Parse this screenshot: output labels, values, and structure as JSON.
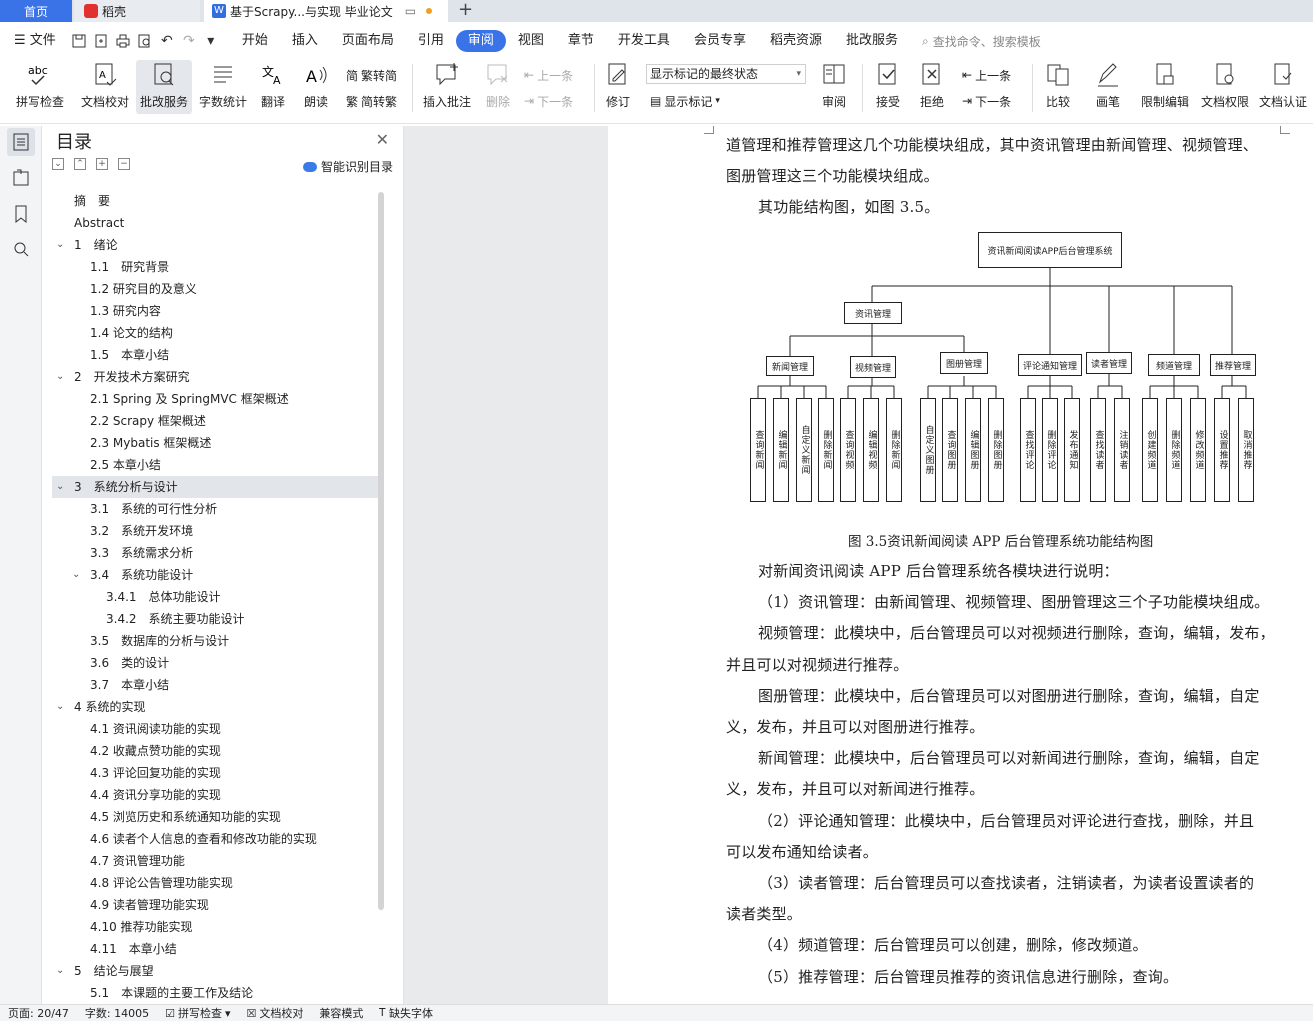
{
  "tabs": {
    "home": "首页",
    "daoke": "稻壳",
    "doc_title": "基于Scrapy...与实现 毕业论文"
  },
  "menu": {
    "file": "文件",
    "items": [
      "开始",
      "插入",
      "页面布局",
      "引用",
      "审阅",
      "视图",
      "章节",
      "开发工具",
      "会员专享",
      "稻壳资源",
      "批改服务"
    ],
    "search_placeholder": "查找命令、搜索模板"
  },
  "ribbon": {
    "spell_check": "拼写检查",
    "doc_proof": "文档校对",
    "correction_service": "批改服务",
    "word_count": "字数统计",
    "translate": "翻译",
    "read_aloud": "朗读",
    "trad_to_simp": "繁转简",
    "simp_to_trad": "简转繁",
    "insert_comment": "插入批注",
    "delete": "删除",
    "prev_item": "上一条",
    "next_item": "下一条",
    "revise": "修订",
    "markup_state": "显示标记的最终状态",
    "show_markup": "显示标记",
    "review": "审阅",
    "accept": "接受",
    "reject": "拒绝",
    "prev_change": "上一条",
    "next_change": "下一条",
    "compare": "比较",
    "ink": "画笔",
    "restrict_edit": "限制编辑",
    "doc_permission": "文档权限",
    "doc_cert": "文档认证"
  },
  "toc": {
    "title": "目录",
    "smart_label": "智能识别目录",
    "items": [
      {
        "text": "摘　要",
        "level": 0
      },
      {
        "text": "Abstract",
        "level": 0
      },
      {
        "text": "1　绪论",
        "level": 1,
        "expanded": true
      },
      {
        "text": "1.1　研究背景",
        "level": 2
      },
      {
        "text": "1.2  研究目的及意义",
        "level": 2
      },
      {
        "text": "1.3  研究内容",
        "level": 2
      },
      {
        "text": "1.4  论文的结构",
        "level": 2
      },
      {
        "text": "1.5　本章小结",
        "level": 2
      },
      {
        "text": "2　开发技术方案研究",
        "level": 1,
        "expanded": true
      },
      {
        "text": "2.1 Spring 及 SpringMVC 框架概述",
        "level": 2
      },
      {
        "text": "2.2 Scrapy 框架概述",
        "level": 2
      },
      {
        "text": "2.3 Mybatis 框架概述",
        "level": 2
      },
      {
        "text": "2.5  本章小结",
        "level": 2
      },
      {
        "text": "3　系统分析与设计",
        "level": 1,
        "expanded": true,
        "selected": true
      },
      {
        "text": "3.1　系统的可行性分析",
        "level": 2
      },
      {
        "text": "3.2　系统开发环境",
        "level": 2
      },
      {
        "text": "3.3　系统需求分析",
        "level": 2
      },
      {
        "text": "3.4　系统功能设计",
        "level": 2,
        "expanded": true
      },
      {
        "text": "3.4.1　总体功能设计",
        "level": 3
      },
      {
        "text": "3.4.2　系统主要功能设计",
        "level": 3
      },
      {
        "text": "3.5　数据库的分析与设计",
        "level": 2
      },
      {
        "text": "3.6　类的设计",
        "level": 2
      },
      {
        "text": "3.7　本章小结",
        "level": 2
      },
      {
        "text": "4 系统的实现",
        "level": 1,
        "expanded": true
      },
      {
        "text": "4.1  资讯阅读功能的实现",
        "level": 2
      },
      {
        "text": "4.2 收藏点赞功能的实现",
        "level": 2
      },
      {
        "text": "4.3 评论回复功能的实现",
        "level": 2
      },
      {
        "text": "4.4 资讯分享功能的实现",
        "level": 2
      },
      {
        "text": "4.5 浏览历史和系统通知功能的实现",
        "level": 2
      },
      {
        "text": "4.6 读者个人信息的查看和修改功能的实现",
        "level": 2
      },
      {
        "text": "4.7 资讯管理功能",
        "level": 2
      },
      {
        "text": "4.8 评论公告管理功能实现",
        "level": 2
      },
      {
        "text": "4.9 读者管理功能实现",
        "level": 2
      },
      {
        "text": "4.10 推荐功能实现",
        "level": 2
      },
      {
        "text": "4.11　本章小结",
        "level": 2
      },
      {
        "text": "5　结论与展望",
        "level": 1,
        "expanded": true
      },
      {
        "text": "5.1　本课题的主要工作及结论",
        "level": 2
      }
    ]
  },
  "document": {
    "lines": [
      {
        "text": "道管理和推荐管理这几个功能模块组成，其中资讯管理由新闻管理、视频管理、",
        "indent": false
      },
      {
        "text": "图册管理这三个功能模块组成。",
        "indent": false
      },
      {
        "text": "其功能结构图，如图 3.5。",
        "indent": true
      }
    ],
    "figure_caption": "图 3.5资讯新闻阅读 APP 后台管理系统功能结构图",
    "body": [
      {
        "text": "对新闻资讯阅读 APP 后台管理系统各模块进行说明：",
        "indent": true
      },
      {
        "text": "（1）资讯管理：由新闻管理、视频管理、图册管理这三个子功能模块组成。",
        "indent": true
      },
      {
        "text": "视频管理：此模块中，后台管理员可以对视频进行删除，查询，编辑，发布，",
        "indent": true
      },
      {
        "text": "并且可以对视频进行推荐。",
        "indent": false
      },
      {
        "text": "图册管理：此模块中，后台管理员可以对图册进行删除，查询，编辑，自定",
        "indent": true
      },
      {
        "text": "义，发布，并且可以对图册进行推荐。",
        "indent": false
      },
      {
        "text": "新闻管理：此模块中，后台管理员可以对新闻进行删除，查询，编辑，自定",
        "indent": true
      },
      {
        "text": "义，发布，并且可以对新闻进行推荐。",
        "indent": false
      },
      {
        "text": "（2）评论通知管理：此模块中，后台管理员对评论进行查找，删除，并且",
        "indent": true
      },
      {
        "text": "可以发布通知给读者。",
        "indent": false
      },
      {
        "text": "（3）读者管理：后台管理员可以查找读者，注销读者，为读者设置读者的",
        "indent": true
      },
      {
        "text": "读者类型。",
        "indent": false
      },
      {
        "text": "（4）频道管理：后台管理员可以创建，删除，修改频道。",
        "indent": true
      },
      {
        "text": "（5）推荐管理：后台管理员推荐的资讯信息进行删除，查询。",
        "indent": true
      }
    ]
  },
  "diagram": {
    "root": "资讯新闻阅读APP后台管理系统",
    "info_mgmt": "资讯管理",
    "news": {
      "label": "新闻管理",
      "leaves": [
        "查询新闻",
        "编辑新闻",
        "自定义新闻",
        "删除新闻"
      ]
    },
    "video": {
      "label": "视频管理",
      "leaves": [
        "查询视频",
        "编辑视频",
        "删除新闻"
      ]
    },
    "album": {
      "label": "图册管理",
      "leaves": [
        "自定义图册",
        "查询图册",
        "编辑图册",
        "删除图册"
      ]
    },
    "comment": {
      "label": "评论通知管理",
      "leaves": [
        "查找评论",
        "删除评论",
        "发布通知"
      ]
    },
    "reader": {
      "label": "读者管理",
      "leaves": [
        "查找读者",
        "注销读者"
      ]
    },
    "channel": {
      "label": "频道管理",
      "leaves": [
        "创建频道",
        "删除频道",
        "修改频道"
      ]
    },
    "recommend": {
      "label": "推荐管理",
      "leaves": [
        "设置推荐",
        "取消推荐"
      ]
    }
  },
  "status": {
    "page": "页面: 20/47",
    "words": "字数: 14005",
    "spell": "拼写检查",
    "proof": "文档校对",
    "compat": "兼容模式",
    "missing_font": "缺失字体"
  }
}
